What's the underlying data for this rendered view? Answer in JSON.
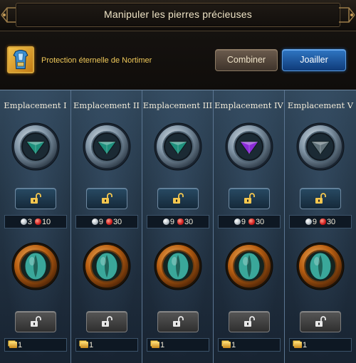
{
  "window": {
    "title": "Manipuler les pierres précieuses"
  },
  "item": {
    "name": "Protection éternelle de Nortimer",
    "icon": "armor-icon"
  },
  "buttons": {
    "combine": "Combiner",
    "jeweler": "Joailler"
  },
  "colors": {
    "gem_teal": "#1e8f7c",
    "gem_purple": "#8a2bd6",
    "gem_grey": "#5f7078",
    "ring_steel": "#8ea4b6",
    "ring_bronze": "#c86f1a",
    "eye_gem": "#3aa79a",
    "jeweler_button": "#1f5aa0",
    "panel_blue": "#24384c"
  },
  "slots": [
    {
      "label": "Emplacement I",
      "gem_color": "#1e8f7c",
      "silver": "3",
      "ruby": "10",
      "gold": "1"
    },
    {
      "label": "Emplacement II",
      "gem_color": "#1e8f7c",
      "silver": "9",
      "ruby": "30",
      "gold": "1"
    },
    {
      "label": "Emplacement III",
      "gem_color": "#1e8f7c",
      "silver": "9",
      "ruby": "30",
      "gold": "1"
    },
    {
      "label": "Emplacement IV",
      "gem_color": "#8a2bd6",
      "silver": "9",
      "ruby": "30",
      "gold": "1"
    },
    {
      "label": "Emplacement V",
      "gem_color": "#5f7078",
      "silver": "9",
      "ruby": "30",
      "gold": "1"
    }
  ]
}
